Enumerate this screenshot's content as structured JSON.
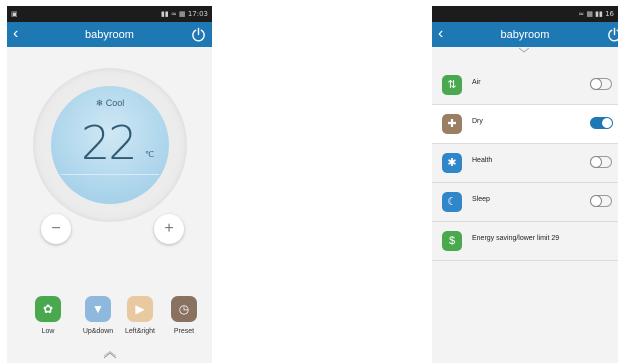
{
  "left_screen": {
    "statusbar": {
      "left_icon": "screenshot-icon",
      "right": "  17:03"
    },
    "title": "babyroom",
    "mode_icon": "snowflake-icon",
    "mode": "Cool",
    "temperature": "22",
    "unit": "℃",
    "minus_label": "−",
    "plus_label": "+",
    "functions": [
      {
        "label": "Low",
        "icon": "fan-speed-icon",
        "color": "#4aa84f"
      },
      {
        "label": "Up&down",
        "icon": "swing-updown-icon",
        "color": "#8fb8de"
      },
      {
        "label": "Left&right",
        "icon": "swing-leftright-icon",
        "color": "#e8c9a0"
      },
      {
        "label": "Preset",
        "icon": "clock-icon",
        "color": "#8a7260"
      }
    ]
  },
  "right_screen": {
    "statusbar": {
      "right": "16"
    },
    "title": "babyroom",
    "items": [
      {
        "label": "Air",
        "icon": "air-icon",
        "color": "#4aa84f",
        "on": false
      },
      {
        "label": "Dry",
        "icon": "dry-icon",
        "color": "#9a7f63",
        "on": true
      },
      {
        "label": "Health",
        "icon": "health-icon",
        "color": "#2f86c8",
        "on": false
      },
      {
        "label": "Sleep",
        "icon": "sleep-icon",
        "color": "#2f86c8",
        "on": false
      },
      {
        "label": "Energy saving/lower limit 29",
        "icon": "dollar-icon",
        "color": "#4aa84f",
        "on": null
      }
    ]
  },
  "colors": {
    "titlebar": "#1e78b4",
    "statusbar": "#1c1c1c",
    "background": "#f3f3f3"
  }
}
